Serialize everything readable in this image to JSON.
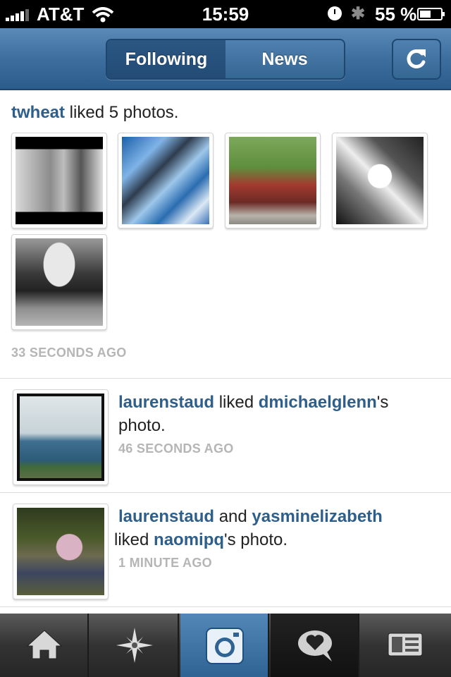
{
  "status_bar": {
    "carrier": "AT&T",
    "time": "15:59",
    "battery_percent": "55 %",
    "battery_level": 0.55
  },
  "nav": {
    "tabs": [
      "Following",
      "News"
    ],
    "selected_tab": "Following",
    "refresh_icon": "refresh-icon"
  },
  "feed": {
    "group": {
      "user": "twheat",
      "action": " liked 5 photos.",
      "time_ago": "33 SECONDS AGO"
    },
    "items": [
      {
        "user1": "laurenstaud",
        "mid": " liked ",
        "user2": "dmichaelglenn",
        "tail": "'s photo.",
        "time_ago": "46 SECONDS AGO"
      },
      {
        "user1": "laurenstaud",
        "mid": " and ",
        "user2": "yasminelizabeth",
        "mid2": " liked ",
        "user3": "naomipq",
        "tail": "'s photo.",
        "time_ago": "1 MINUTE AGO"
      }
    ]
  },
  "tab_bar": {
    "icons": [
      "home-icon",
      "explore-star-icon",
      "camera-icon",
      "news-heart-bubble-icon",
      "profile-card-icon"
    ]
  },
  "colors": {
    "nav_blue": "#3d6e9e",
    "username_blue": "#2e5e8a",
    "timestamp_gray": "#b5b5b5"
  }
}
